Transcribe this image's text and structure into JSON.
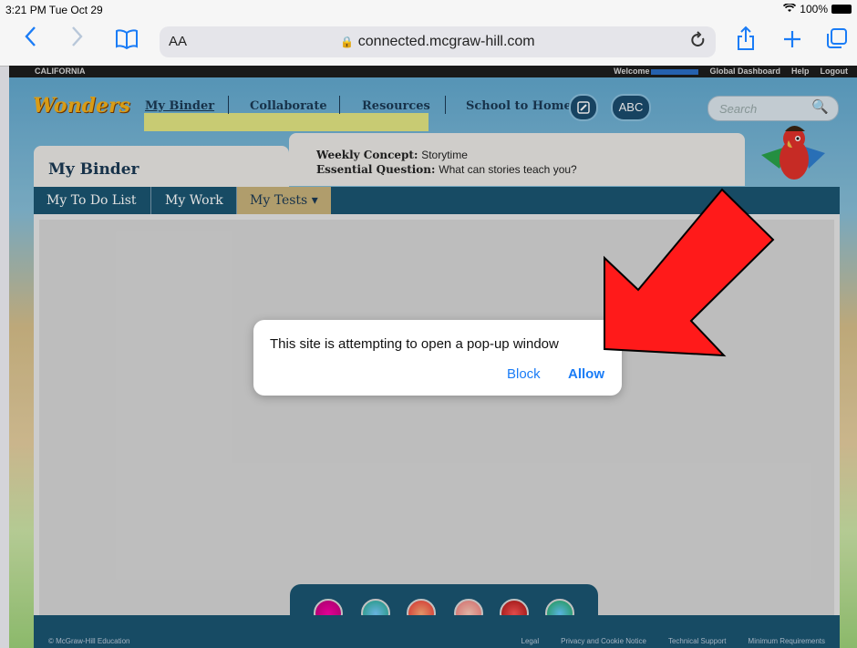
{
  "status_bar": {
    "time": "3:21 PM  Tue Oct 29",
    "battery": "100%",
    "wifi_icon": "wifi-icon"
  },
  "browser": {
    "back_icon": "chevron-left-icon",
    "forward_icon": "chevron-right-icon",
    "bookmarks_icon": "book-icon",
    "text_size_label": "AA",
    "url": "connected.mcgraw-hill.com",
    "reload_icon": "reload-icon",
    "share_icon": "share-icon",
    "new_tab_icon": "plus-icon",
    "tabs_icon": "tabs-icon"
  },
  "site": {
    "region": "CALIFORNIA",
    "welcome_label": "Welcome",
    "top_links": [
      "Global Dashboard",
      "Help",
      "Logout"
    ],
    "logo_text": "Wonders",
    "nav": [
      "My Binder",
      "Collaborate",
      "Resources",
      "School to Home"
    ],
    "abc_label": "ABC",
    "search_placeholder": "Search",
    "binder_title": "My Binder",
    "weekly_concept_label": "Weekly Concept:",
    "weekly_concept_value": "Storytime",
    "essential_question_label": "Essential Question:",
    "essential_question_value": "What can stories teach you?",
    "tabs": [
      "My To Do List",
      "My Work",
      "My Tests"
    ],
    "active_tab_chevron": "▾",
    "footer_copyright": "© McGraw-Hill Education",
    "footer_links": [
      "Legal",
      "Privacy and Cookie Notice",
      "Technical Support",
      "Minimum Requirements"
    ]
  },
  "dialog": {
    "message": "This site is attempting to open a pop-up window",
    "block_label": "Block",
    "allow_label": "Allow"
  },
  "colors": {
    "ios_blue": "#1a7cf6",
    "site_teal": "#1b5672",
    "arrow_red": "#ff1a1a"
  }
}
